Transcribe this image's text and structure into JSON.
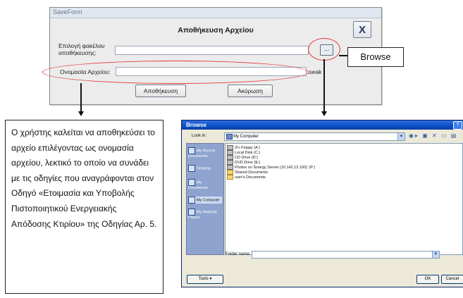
{
  "saveform": {
    "window_title": "SaveForm",
    "heading": "Αποθήκευση Αρχείου",
    "close_glyph": "X",
    "folder_label": "Επιλογή φακέλου αποθήκευσης:",
    "folder_value": "",
    "browse_button": "...",
    "filename_label": "Ονομασία Αρχείου:",
    "filename_value": "",
    "extension": ".seak",
    "save_button": "Αποθήκευση",
    "cancel_button": "Ακύρωση"
  },
  "callout": {
    "text": "Browse"
  },
  "instruction": {
    "text": "Ο χρήστης καλείται να αποθηκεύσει το αρχείο επιλέγοντας ως ονομασία αρχείου, λεκτικό το οποίο να συνάδει με τις οδηγίες που αναγράφονται στον Οδηγό «Ετοιμασία και Υποβολής Πιστοποιητικού Ενεργειακής Απόδοσης Κτιρίου» της Οδηγίας Αρ. 5."
  },
  "browse_dialog": {
    "title": "Browse",
    "help_glyph": "?",
    "look_in_label": "Look in:",
    "look_in_value": "My Computer",
    "places": [
      "My Recent Documents",
      "Desktop",
      "My Documents",
      "My Computer",
      "My Network Places"
    ],
    "items": [
      "3½ Floppy (A:)",
      "Local Disk (C:)",
      "CD Drive (D:)",
      "DVD Drive (E:)",
      "Photos on 'Energy Server (10.142.12.100)' (P:)",
      "Shared Documents",
      "user's Documents"
    ],
    "folder_name_label": "Folder name:",
    "folder_name_value": "",
    "tools_button": "Tools",
    "ok_button": "OK",
    "cancel_button": "Cancel"
  },
  "colors": {
    "annotation_red": "#e33a3a",
    "dialog_title_blue": "#0a4fc8"
  }
}
